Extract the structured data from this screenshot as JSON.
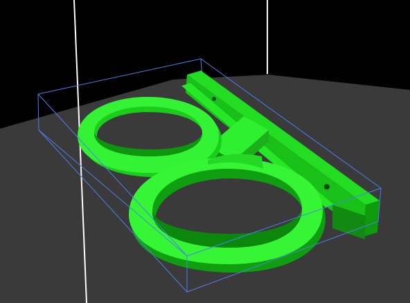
{
  "scene": {
    "type": "3d-slicer-preview",
    "colors": {
      "background": "#000000",
      "build_plate": "#3a3a3a",
      "bounding_box": "#4f7ff0",
      "axis_lines": "#ffffff",
      "model_light": "#33ff33",
      "model_mid": "#1fd61f",
      "model_dark": "#0c8f0c",
      "model_shadow": "#065a06"
    },
    "model": {
      "name": "glasses-frame",
      "parts": [
        "rear-ring",
        "front-ring",
        "bridge",
        "side-rail"
      ]
    }
  }
}
